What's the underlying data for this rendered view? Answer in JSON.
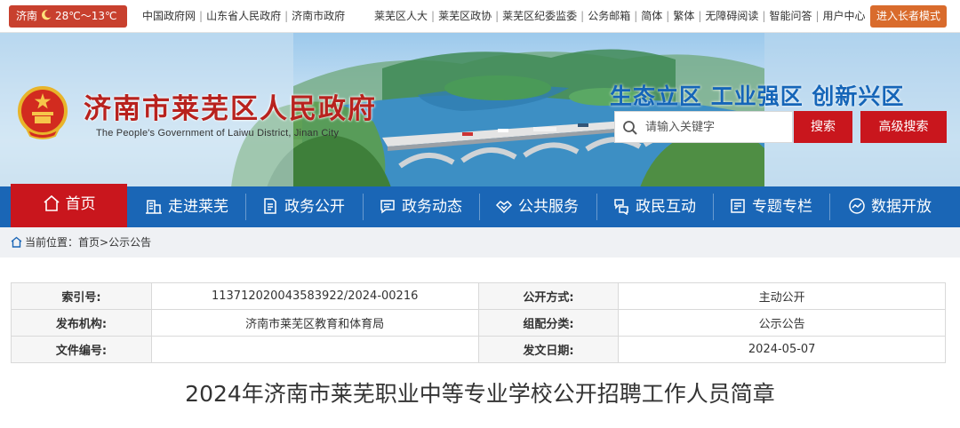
{
  "weather": {
    "city": "济南",
    "temperature": "28℃～13℃"
  },
  "top_links": [
    "中国政府网",
    "山东省人民政府",
    "济南市政府"
  ],
  "top_links_right": [
    "莱芜区人大",
    "莱芜区政协",
    "莱芜区纪委监委",
    "公务邮箱",
    "简体",
    "繁体",
    "无障碍阅读",
    "智能问答",
    "用户中心"
  ],
  "elder_mode_label": "进入长者模式",
  "site": {
    "title": "济南市莱芜区人民政府",
    "subtitle": "The People's Government of Laiwu District, Jinan City",
    "slogan": "生态立区  工业强区  创新兴区"
  },
  "search": {
    "placeholder": "请输入关键字",
    "button": "搜索",
    "advanced": "高级搜索"
  },
  "nav": [
    {
      "label": "首页",
      "icon": "home-icon"
    },
    {
      "label": "走进莱芜",
      "icon": "building-icon"
    },
    {
      "label": "政务公开",
      "icon": "document-icon"
    },
    {
      "label": "政务动态",
      "icon": "chat-icon"
    },
    {
      "label": "公共服务",
      "icon": "handshake-icon"
    },
    {
      "label": "政民互动",
      "icon": "interaction-icon"
    },
    {
      "label": "专题专栏",
      "icon": "topic-icon"
    },
    {
      "label": "数据开放",
      "icon": "data-icon"
    }
  ],
  "breadcrumb": {
    "prefix": "当前位置：",
    "path": "首页>公示公告"
  },
  "info": {
    "index_label": "索引号:",
    "index_value": "11371202004358392​2/2024-00216",
    "mode_label": "公开方式:",
    "mode_value": "主动公开",
    "publisher_label": "发布机构:",
    "publisher_value": "济南市莱芜区教育和体育局",
    "category_label": "组配分类:",
    "category_value": "公示公告",
    "docno_label": "文件编号:",
    "docno_value": "",
    "date_label": "发文日期:",
    "date_value": "2024-05-07"
  },
  "doc_title": "2024年济南市莱芜职业中等专业学校公开招聘工作人员简章",
  "colors": {
    "primary_blue": "#1a66b6",
    "accent_red": "#c9161d",
    "elder_orange": "#d96b2c"
  }
}
